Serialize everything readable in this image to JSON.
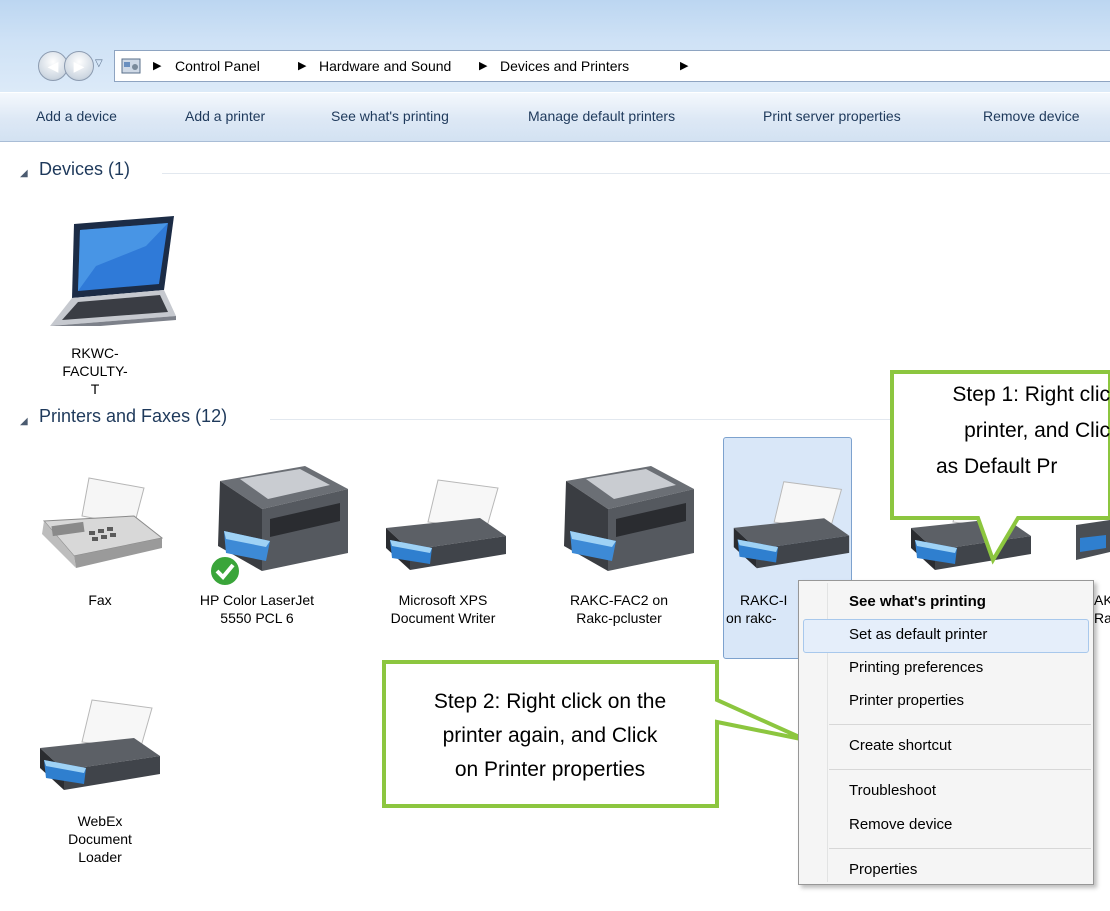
{
  "breadcrumbs": [
    "Control Panel",
    "Hardware and Sound",
    "Devices and Printers"
  ],
  "toolbar": [
    "Add a device",
    "Add a printer",
    "See what's printing",
    "Manage default printers",
    "Print server properties",
    "Remove device"
  ],
  "devices_group": "Devices (1)",
  "devices": [
    {
      "line1": "RKWC-FACULTY-",
      "line2": "T",
      "icon": "laptop-icon"
    }
  ],
  "printers_group": "Printers and Faxes (12)",
  "printers": [
    {
      "line1": "Fax",
      "line2": "",
      "icon": "fax-icon"
    },
    {
      "line1": "HP Color LaserJet",
      "line2": "5550 PCL 6",
      "icon": "laser-printer-icon",
      "default": true
    },
    {
      "line1": "Microsoft XPS",
      "line2": "Document Writer",
      "icon": "printer-icon"
    },
    {
      "line1": "RAKC-FAC2 on",
      "line2": "Rakc-pcluster",
      "icon": "laser-printer-icon"
    },
    {
      "line1": "RAKC-I",
      "line2": "on rakc-",
      "icon": "printer-icon",
      "selected": true
    },
    {
      "line1": "",
      "line2": "",
      "icon": "printer-icon"
    },
    {
      "line1": "AK",
      "line2": "Ra",
      "icon": "printer-icon"
    },
    {
      "line1": "WebEx",
      "line2": "Document",
      "line3": "Loader",
      "icon": "printer-icon"
    }
  ],
  "context_menu": {
    "items": [
      "See what's printing",
      "Set as default printer",
      "Printing preferences",
      "Printer properties",
      "Create shortcut",
      "Troubleshoot",
      "Remove device",
      "Properties"
    ],
    "highlighted": "Set as default printer"
  },
  "callouts": {
    "step1": [
      "Step 1: Right clic",
      "printer, and Clic",
      "as Default Pr"
    ],
    "step2": [
      "Step 2: Right click on the",
      "printer again, and Click",
      "on Printer properties"
    ]
  },
  "colors": {
    "callout_border": "#8cc63f",
    "group_header": "#1e395b",
    "selection": "#d9e7f8"
  }
}
